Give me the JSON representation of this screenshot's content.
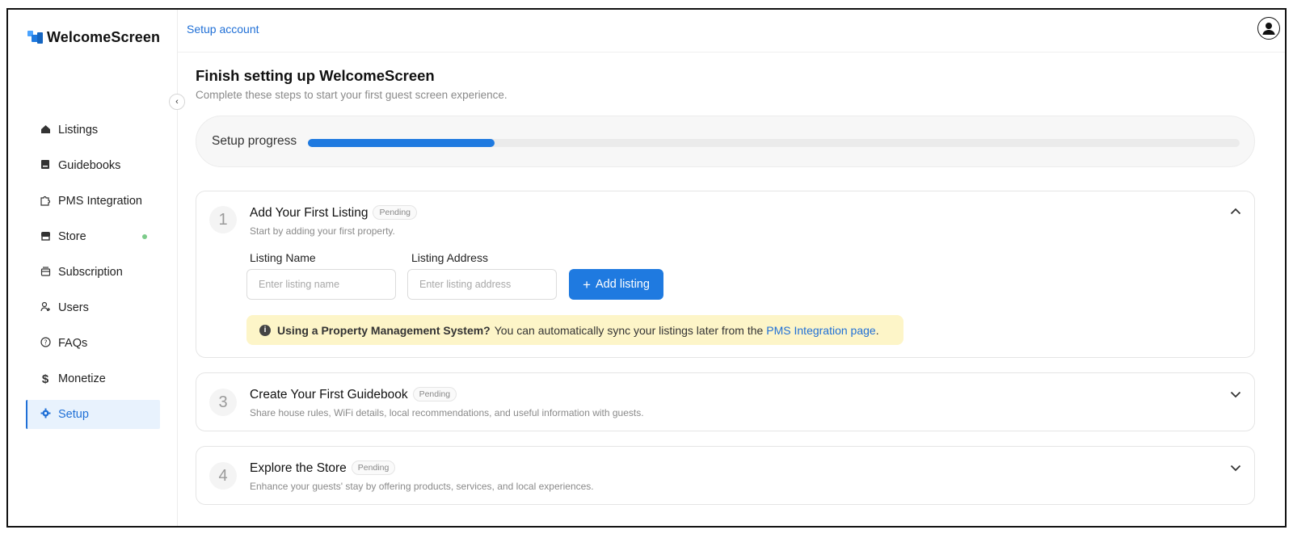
{
  "app": {
    "name": "WelcomeScreen"
  },
  "breadcrumb": "Setup account",
  "sidebar": {
    "items": [
      {
        "label": "Listings",
        "icon": "home-icon"
      },
      {
        "label": "Guidebooks",
        "icon": "book-icon"
      },
      {
        "label": "PMS Integration",
        "icon": "puzzle-icon"
      },
      {
        "label": "Store",
        "icon": "store-icon"
      },
      {
        "label": "Subscription",
        "icon": "subscription-icon"
      },
      {
        "label": "Users",
        "icon": "users-icon"
      },
      {
        "label": "FAQs",
        "icon": "help-icon"
      },
      {
        "label": "Monetize",
        "icon": "dollar-icon"
      },
      {
        "label": "Setup",
        "icon": "gear-icon",
        "active": true
      }
    ]
  },
  "page": {
    "title": "Finish setting up WelcomeScreen",
    "subtitle": "Complete these steps to start your first guest screen experience."
  },
  "progress": {
    "label": "Setup progress",
    "fraction": 0.2
  },
  "steps": [
    {
      "number": "1",
      "title": "Add Your First Listing",
      "badge": "Pending",
      "description": "Start by adding your first property.",
      "expanded": true,
      "form": {
        "name_label": "Listing Name",
        "name_placeholder": "Enter listing name",
        "address_label": "Listing Address",
        "address_placeholder": "Enter listing address",
        "button_label": "Add listing",
        "button_icon": "+"
      },
      "notice": {
        "bold": "Using a Property Management System?",
        "text": "You can automatically sync your listings later from the",
        "link": "PMS Integration page",
        "end": "."
      }
    },
    {
      "number": "3",
      "title": "Create Your First Guidebook",
      "badge": "Pending",
      "description": "Share house rules, WiFi details, local recommendations, and useful information with guests.",
      "expanded": false
    },
    {
      "number": "4",
      "title": "Explore the Store",
      "badge": "Pending",
      "description": "Enhance your guests' stay by offering products, services, and local experiences.",
      "expanded": false
    }
  ],
  "colors": {
    "accent": "#1f7ae0",
    "notice_bg": "#fdf5c8",
    "active_bg": "#e8f2fd",
    "store_dot": "#7ccb8a"
  }
}
